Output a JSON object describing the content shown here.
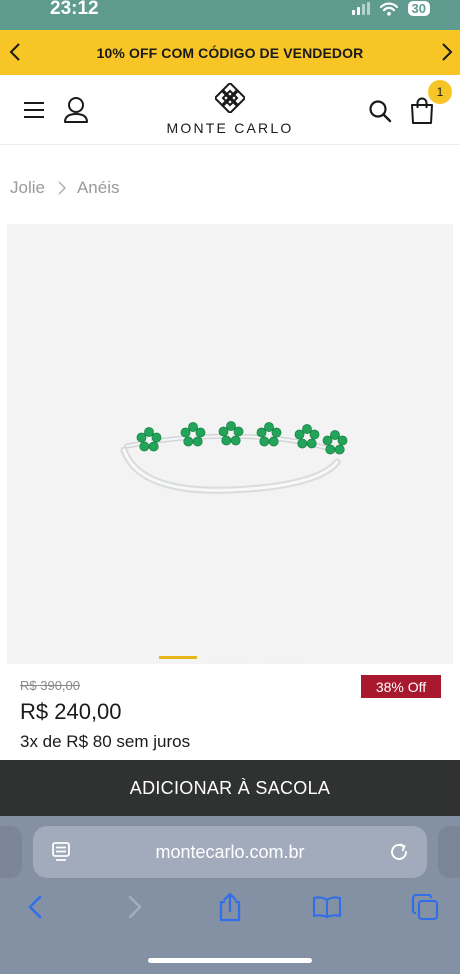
{
  "status": {
    "time": "23:12",
    "battery": "30"
  },
  "promo": {
    "text": "10% OFF COM CÓDIGO DE VENDEDOR"
  },
  "header": {
    "brand": "MONTE CARLO",
    "cart_count": "1"
  },
  "breadcrumb": [
    {
      "label": "Jolie"
    },
    {
      "label": "Anéis"
    }
  ],
  "gallery": {
    "dot_count": 3,
    "active_dot": 0
  },
  "product": {
    "old_price": "R$ 390,00",
    "price": "R$ 240,00",
    "installments": "3x de R$ 80 sem juros",
    "discount_badge": "38% Off"
  },
  "cta": {
    "add_to_bag": "ADICIONAR À SACOLA"
  },
  "browser": {
    "url": "montecarlo.com.br"
  },
  "colors": {
    "status_bar": "#5f9b8e",
    "promo": "#f7c525",
    "discount": "#a8192e",
    "cta": "#303131",
    "emerald": "#22a45a",
    "browser_chrome": "#8490a3",
    "browser_accent": "#2f6fea"
  },
  "icons": {
    "status": [
      "signal-icon",
      "wifi-icon",
      "battery-icon"
    ],
    "header": [
      "menu-icon",
      "user-icon",
      "logo-mark-icon",
      "search-icon",
      "bag-icon"
    ],
    "browser": [
      "reader-icon",
      "reload-icon",
      "back-icon",
      "forward-icon",
      "share-icon",
      "bookmarks-icon",
      "tabs-icon"
    ]
  }
}
